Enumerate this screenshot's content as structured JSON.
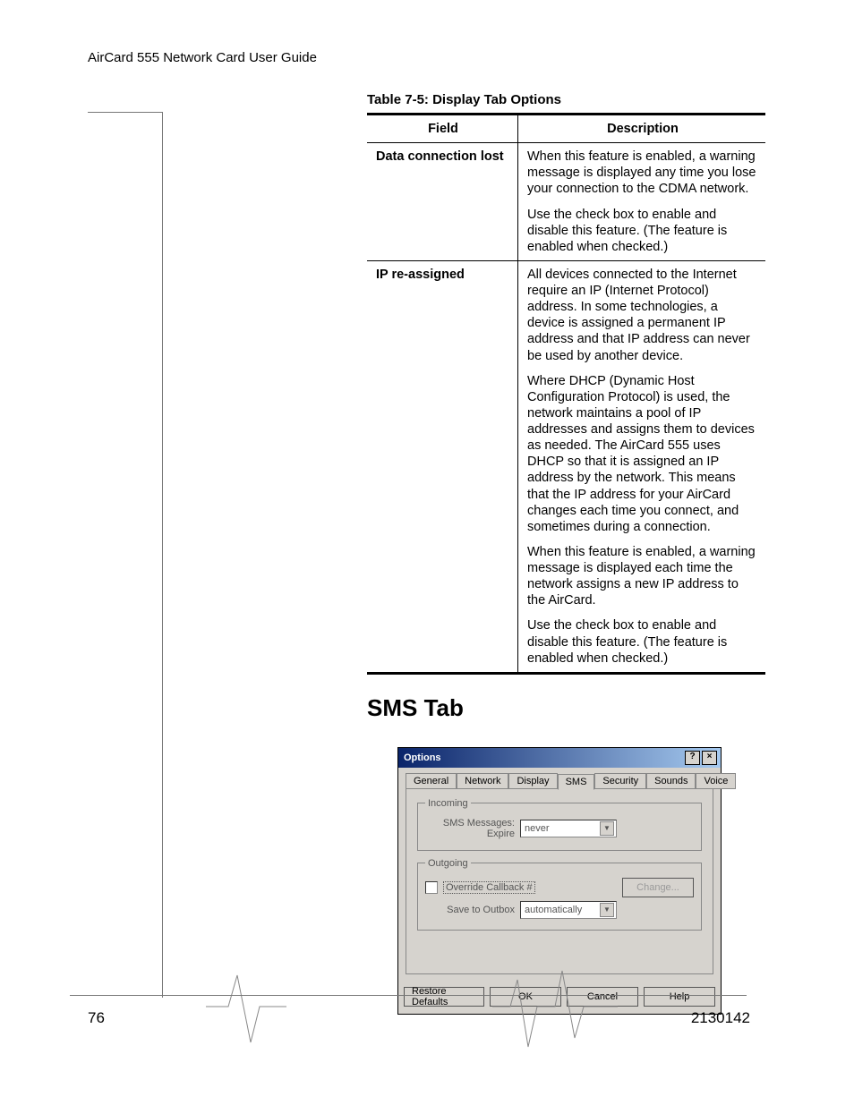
{
  "doc_header": "AirCard 555 Network Card User Guide",
  "table_caption": "Table 7-5: Display Tab Options",
  "table_headers": {
    "field": "Field",
    "description": "Description"
  },
  "rows": [
    {
      "field": "Data connection lost",
      "desc_p1": "When this feature is enabled, a warning message is displayed any time you lose your connection to the CDMA network.",
      "desc_p2": "Use the check box to enable and disable this feature. (The feature is enabled when checked.)"
    },
    {
      "field": "IP re-assigned",
      "desc_p1": "All devices connected to the Internet require an IP (Internet Protocol) address. In some technologies, a device is assigned a permanent IP address and that IP address can never be used by another device.",
      "desc_p2": "Where DHCP (Dynamic Host Configuration Protocol) is used, the network maintains a pool of IP addresses and assigns them to devices as needed. The AirCard 555 uses DHCP so that it is assigned an IP address by the network. This means that the IP address for your AirCard changes each time you connect, and sometimes during a connection.",
      "desc_p3": "When this feature is enabled, a warning message is displayed each time the network assigns a new IP address to the AirCard.",
      "desc_p4": "Use the check box to enable and disable this feature. (The feature is enabled when checked.)"
    }
  ],
  "section_heading": "SMS Tab",
  "dialog": {
    "title": "Options",
    "help_glyph": "?",
    "close_glyph": "×",
    "tabs": [
      "General",
      "Network",
      "Display",
      "SMS",
      "Security",
      "Sounds",
      "Voice"
    ],
    "active_tab": "SMS",
    "incoming": {
      "legend": "Incoming",
      "label": "SMS Messages: Expire",
      "value": "never"
    },
    "outgoing": {
      "legend": "Outgoing",
      "override_label": "Override Callback #",
      "change_label": "Change...",
      "save_label": "Save to Outbox",
      "save_value": "automatically"
    },
    "buttons": {
      "restore": "Restore Defaults",
      "ok": "OK",
      "cancel": "Cancel",
      "help": "Help"
    }
  },
  "page_number": "76",
  "doc_number": "2130142"
}
